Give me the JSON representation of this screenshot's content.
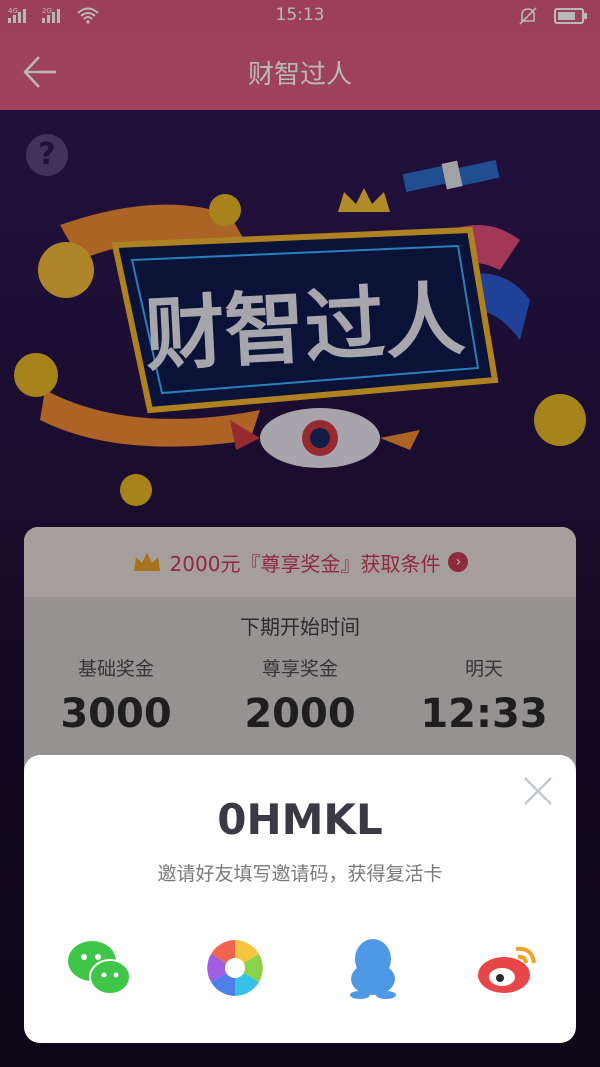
{
  "status_bar": {
    "time": "15:13",
    "network_1": "4G",
    "network_2": "2G",
    "icons": [
      "signal-icon",
      "signal-icon",
      "wifi-icon",
      "mute-bell-icon",
      "battery-icon"
    ]
  },
  "header": {
    "title": "财智过人",
    "back_icon": "back-arrow-icon"
  },
  "hero": {
    "logo_text": "财智过人"
  },
  "info_card": {
    "condition_text": "2000元『尊享奖金』获取条件",
    "next_period_label": "下期开始时间",
    "columns": [
      {
        "label": "基础奖金",
        "value": "3000"
      },
      {
        "label": "尊享奖金",
        "value": "2000"
      },
      {
        "label": "明天",
        "value": "12:33"
      }
    ]
  },
  "invite_sheet": {
    "code": "0HMKL",
    "hint": "邀请好友填写邀请码，获得复活卡",
    "share_targets": [
      {
        "name": "wechat",
        "icon": "wechat-icon"
      },
      {
        "name": "moments",
        "icon": "moments-icon"
      },
      {
        "name": "qq",
        "icon": "qq-icon"
      },
      {
        "name": "weibo",
        "icon": "weibo-icon"
      }
    ]
  },
  "colors": {
    "header": "#dc5a7d",
    "accent": "#c63b57",
    "background": "#24123f"
  }
}
